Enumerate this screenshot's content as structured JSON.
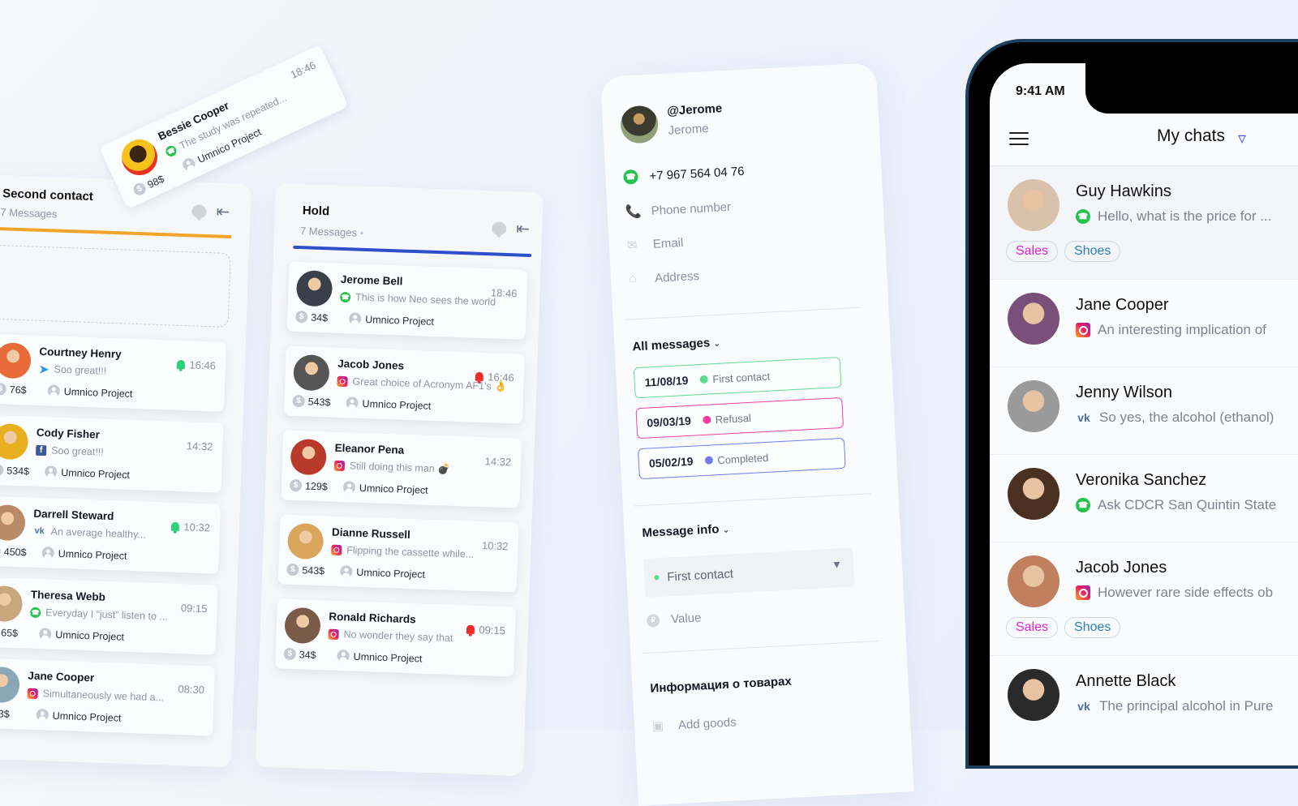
{
  "floating_card": {
    "name": "Bessie Cooper",
    "channel": "whatsapp",
    "message": "The study was repeated...",
    "time": "18:46",
    "amount": "98$",
    "project": "Umnico Project"
  },
  "columns": [
    {
      "title": "Second contact",
      "count": "7 Messages",
      "accent": "#f2a52a",
      "cards": [
        {
          "name": "Courtney Henry",
          "channel": "telegram",
          "message": "Soo great!!!",
          "time": "16:46",
          "alert": "green",
          "amount": "76$",
          "project": "Umnico Project"
        },
        {
          "name": "Cody Fisher",
          "channel": "facebook",
          "message": "Soo great!!!",
          "time": "14:32",
          "alert": "",
          "amount": "534$",
          "project": "Umnico Project"
        },
        {
          "name": "Darrell Steward",
          "channel": "vk",
          "message": "An average healthy...",
          "time": "10:32",
          "alert": "green",
          "amount": "450$",
          "project": "Umnico Project"
        },
        {
          "name": "Theresa Webb",
          "channel": "whatsapp",
          "message": "Everyday I “just” listen to ...",
          "time": "09:15",
          "alert": "",
          "amount": "65$",
          "project": "Umnico Project"
        },
        {
          "name": "Jane Cooper",
          "channel": "instagram",
          "message": "Simultaneously we had a...",
          "time": "08:30",
          "alert": "",
          "amount": "3$",
          "project": "Umnico Project"
        }
      ]
    },
    {
      "title": "Hold",
      "count": "7 Messages",
      "accent": "#2f4fc9",
      "cards": [
        {
          "name": "Jerome Bell",
          "channel": "whatsapp",
          "message": "This is how Neo sees the world",
          "time": "18:46",
          "alert": "",
          "amount": "34$",
          "project": "Umnico Project"
        },
        {
          "name": "Jacob Jones",
          "channel": "instagram",
          "message": "Great choice of Acronym AF1's 👌",
          "time": "16:46",
          "alert": "red",
          "amount": "543$",
          "project": "Umnico Project"
        },
        {
          "name": "Eleanor Pena",
          "channel": "instagram",
          "message": "Still doing this man 💣",
          "time": "14:32",
          "alert": "",
          "amount": "129$",
          "project": "Umnico Project"
        },
        {
          "name": "Dianne Russell",
          "channel": "instagram",
          "message": "Flipping the cassette while...",
          "time": "10:32",
          "alert": "",
          "amount": "543$",
          "project": "Umnico Project"
        },
        {
          "name": "Ronald Richards",
          "channel": "instagram",
          "message": "No wonder they say that",
          "time": "09:15",
          "alert": "red",
          "amount": "34$",
          "project": "Umnico Project"
        }
      ]
    }
  ],
  "contact_panel": {
    "handle": "@Jerome",
    "name": "Jerome",
    "whatsapp_number": "+7 967 564 04 76",
    "phone_placeholder": "Phone number",
    "email_placeholder": "Email",
    "address_placeholder": "Address",
    "all_messages_label": "All messages",
    "history": [
      {
        "date": "11/08/19",
        "status": "First contact",
        "color": "#5fdb8f"
      },
      {
        "date": "09/03/19",
        "status": "Refusal",
        "color": "#f53fa1"
      },
      {
        "date": "05/02/19",
        "status": "Completed",
        "color": "#6f7cf2"
      }
    ],
    "message_info_label": "Message info",
    "stage_select": {
      "value": "First contact",
      "dot_color": "#5fdb8f"
    },
    "value_placeholder": "Value",
    "goods_section": "Информация о товарах",
    "add_goods_label": "Add goods"
  },
  "phone": {
    "status_time": "9:41 AM",
    "title": "My chats",
    "chats": [
      {
        "name": "Guy Hawkins",
        "channel": "whatsapp",
        "message": "Hello, what is the price for ...",
        "tags": [
          "Sales",
          "Shoes"
        ]
      },
      {
        "name": "Jane Cooper",
        "channel": "instagram",
        "message": "An interesting implication of",
        "tags": []
      },
      {
        "name": "Jenny Wilson",
        "channel": "vk",
        "message": "So yes, the alcohol (ethanol)",
        "tags": []
      },
      {
        "name": "Veronika Sanchez",
        "channel": "whatsapp",
        "message": "Ask CDCR San Quintin State",
        "tags": []
      },
      {
        "name": "Jacob Jones",
        "channel": "instagram",
        "message": "However rare side effects ob",
        "tags": [
          "Sales",
          "Shoes"
        ]
      },
      {
        "name": "Annette Black",
        "channel": "vk",
        "message": "The principal alcohol in Pure",
        "tags": []
      }
    ],
    "tag_colors": {
      "Sales": "#e21fd8",
      "Shoes": "#2d7fbf"
    }
  }
}
